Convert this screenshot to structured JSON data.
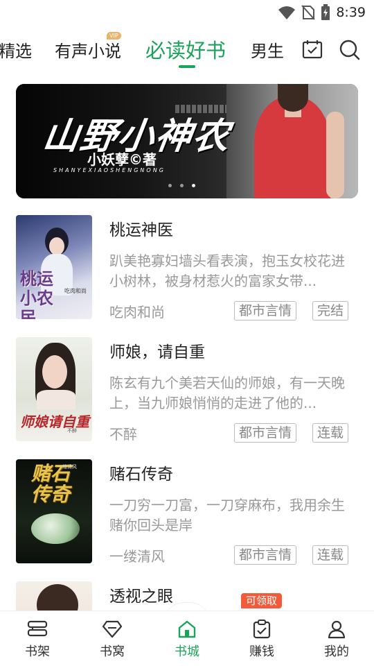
{
  "status_bar": {
    "time": "8:39"
  },
  "top_tabs": {
    "items": [
      {
        "label": "精选"
      },
      {
        "label": "有声小说",
        "badge": "VIP"
      },
      {
        "label": "必读好书",
        "active": true
      },
      {
        "label": "男生"
      }
    ],
    "icons": [
      "calendar-check-icon",
      "search-icon"
    ]
  },
  "banner": {
    "title": "山野小神农",
    "author": "小妖孽©著",
    "pinyin": "SHANYEXIAOSHENGNONG"
  },
  "books": [
    {
      "title": "桃运神医",
      "description": "趴美艳寡妇墙头看表演，抱玉女校花进小树林，被身材惹火的富家女带...",
      "author": "吃肉和尚",
      "category": "都市言情",
      "status": "完结",
      "cover_text": "桃运小农民",
      "cover_author": "吃肉和尚"
    },
    {
      "title": "师娘，请自重",
      "description": "陈玄有九个美若天仙的师娘，有一天晚上，当九师娘悄悄的走进了他的...",
      "author": "不醉",
      "category": "都市言情",
      "status": "连载",
      "cover_text": "师娘请自重",
      "cover_author": "不醉"
    },
    {
      "title": "赌石传奇",
      "description": "一刀穷一刀富，一刀穿麻布，我用余生赌你回头是岸",
      "author": "一缕清风",
      "category": "都市言情",
      "status": "连载",
      "cover_text": "赌石传奇",
      "cover_author": "一缕清风"
    },
    {
      "title": "透视之眼"
    }
  ],
  "claim_badge": "可领取",
  "bottom_nav": [
    {
      "label": "书架",
      "icon": "bookshelf-icon"
    },
    {
      "label": "书窝",
      "icon": "diamond-icon"
    },
    {
      "label": "书城",
      "icon": "home-icon",
      "active": true
    },
    {
      "label": "赚钱",
      "icon": "task-clipboard-icon"
    },
    {
      "label": "我的",
      "icon": "profile-icon"
    }
  ],
  "colors": {
    "accent": "#1aa35a",
    "badge": "#f15a3a",
    "vip": "#e7b46b"
  }
}
